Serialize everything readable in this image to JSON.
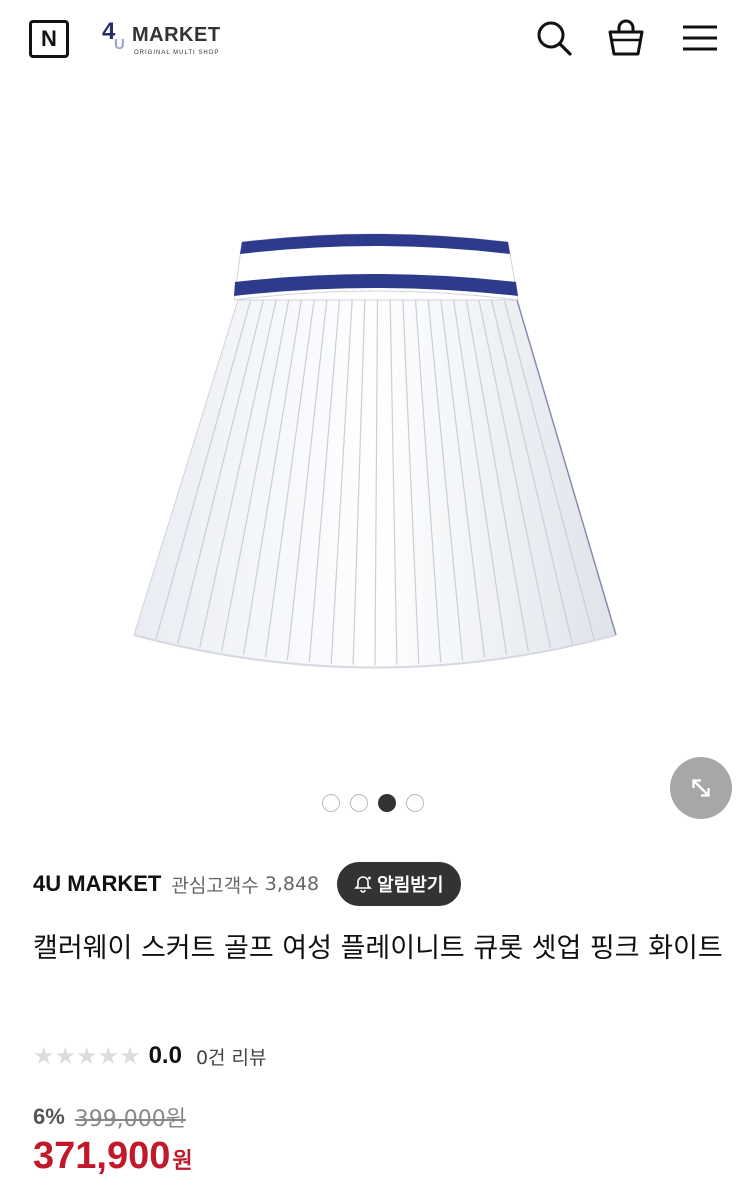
{
  "header": {
    "n_logo": "N",
    "brand": {
      "four": "4",
      "u": "U",
      "market": "MARKET",
      "sub": "ORIGINAL MULTI SHOP"
    }
  },
  "gallery": {
    "total_slides": 4,
    "active_slide": 3
  },
  "seller": {
    "name": "4U MARKET",
    "followers_label": "관심고객수",
    "followers_count": "3,848",
    "alarm_label": "알림받기"
  },
  "product": {
    "title": "캘러웨이 스커트 골프 여성 플레이니트 큐롯 셋업 핑크 화이트"
  },
  "rating": {
    "stars_max": 5,
    "stars_filled": 0,
    "score": "0.0",
    "review_text": "0건 리뷰"
  },
  "price": {
    "discount": "6%",
    "original": "399,000원",
    "current": "371,900",
    "currency": "원"
  },
  "colors": {
    "accent_red": "#c2182b",
    "navy": "#2e3a8c",
    "dark_button": "#333333"
  },
  "icons": [
    "search-icon",
    "shopping-bag-icon",
    "menu-icon",
    "expand-icon",
    "bell-icon",
    "star-icon"
  ]
}
